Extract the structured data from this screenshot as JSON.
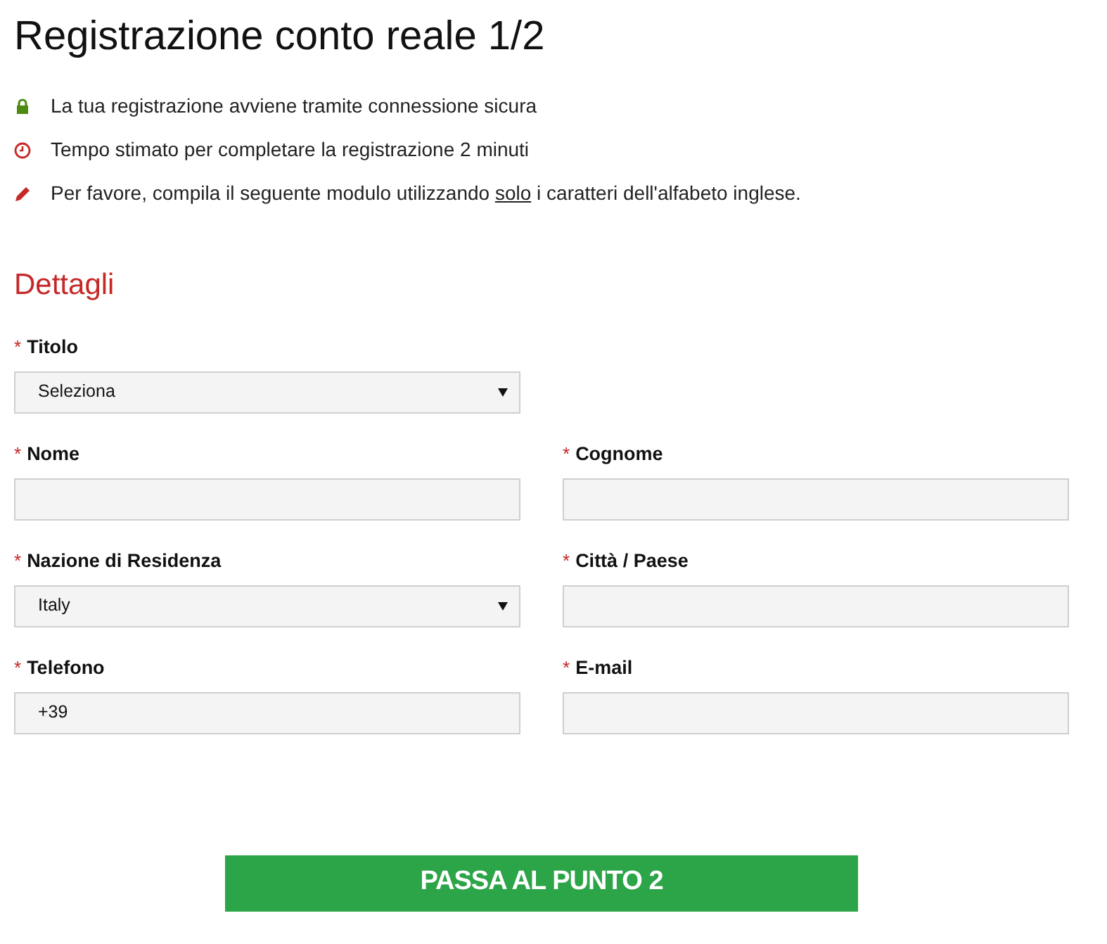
{
  "title": "Registrazione conto reale 1/2",
  "notes": [
    {
      "kind": "lock",
      "text": "La tua registrazione avviene tramite connessione sicura"
    },
    {
      "kind": "clock",
      "text": "Tempo stimato per completare la registrazione 2 minuti"
    },
    {
      "kind": "pencil",
      "text": "Per favore, compila il seguente modulo utilizzando ",
      "underlined": "solo",
      "text_after": " i caratteri dell'alfabeto inglese."
    }
  ],
  "section_title": "Dettagli",
  "rows": [
    [
      {
        "kind": "select",
        "marker": "*",
        "label": "Titolo",
        "value": "Seleziona"
      }
    ],
    [
      {
        "kind": "text",
        "marker": "*",
        "label": "Nome"
      },
      {
        "kind": "text",
        "marker": "*",
        "label": "Cognome"
      }
    ],
    [
      {
        "kind": "select",
        "marker": "*",
        "label": "Nazione di Residenza",
        "value": "Italy"
      },
      {
        "kind": "text",
        "marker": "*",
        "label": "Città / Paese"
      }
    ],
    [
      {
        "kind": "text",
        "marker": "*",
        "label": "Telefono",
        "value": "+39"
      },
      {
        "kind": "text",
        "marker": "*",
        "label": "E-mail"
      }
    ]
  ],
  "submit": "PASSA AL PUNTO 2"
}
